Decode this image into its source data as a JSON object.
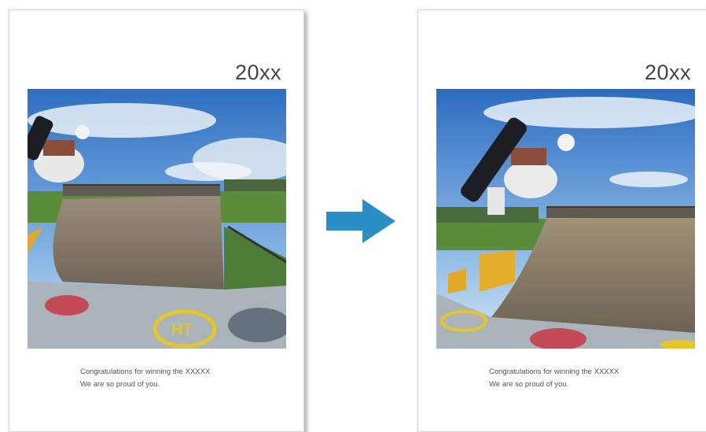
{
  "left_card": {
    "year": "20xx",
    "message_line1": "Congratulations for winning the XXXXX",
    "message_line2": "We are so proud of you."
  },
  "right_card": {
    "year": "20xx",
    "message_line1": "Congratulations for winning the XXXXX",
    "message_line2": "We are so proud of you."
  },
  "arrow": {
    "icon": "arrow-right-icon",
    "color": "#2a8fc4"
  },
  "photo": {
    "subject": "skateboarder-halfpipe-photo"
  }
}
